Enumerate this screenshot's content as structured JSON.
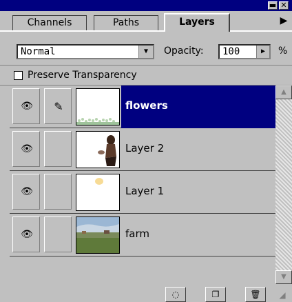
{
  "window": {
    "minimize_glyph": "▬",
    "close_glyph": "✕"
  },
  "tabs": [
    {
      "label": "Channels",
      "active": false
    },
    {
      "label": "Paths",
      "active": false
    },
    {
      "label": "Layers",
      "active": true
    }
  ],
  "tab_menu_arrow": "▶",
  "blend": {
    "mode": "Normal",
    "dropdown_glyph": "▼",
    "opacity_label": "Opacity:",
    "opacity_value": "100",
    "opacity_arrow": "▶",
    "opacity_unit": "%"
  },
  "preserve_transparency": {
    "label": "Preserve Transparency",
    "checked": false
  },
  "layers": [
    {
      "name": "flowers",
      "visible": true,
      "editing": true,
      "selected": true
    },
    {
      "name": "Layer 2",
      "visible": true,
      "editing": false,
      "selected": false
    },
    {
      "name": "Layer 1",
      "visible": true,
      "editing": false,
      "selected": false
    },
    {
      "name": "farm",
      "visible": true,
      "editing": false,
      "selected": false
    }
  ],
  "icons": {
    "eye": "👁",
    "brush": "✎",
    "scroll_up": "▲",
    "scroll_down": "▼",
    "mask": "◌",
    "new_layer": "❐",
    "trash": "🗑",
    "grip": "◢"
  },
  "colors": {
    "panel_bg": "#c0c0c0",
    "selection": "#000080",
    "selection_text": "#ffffff"
  }
}
